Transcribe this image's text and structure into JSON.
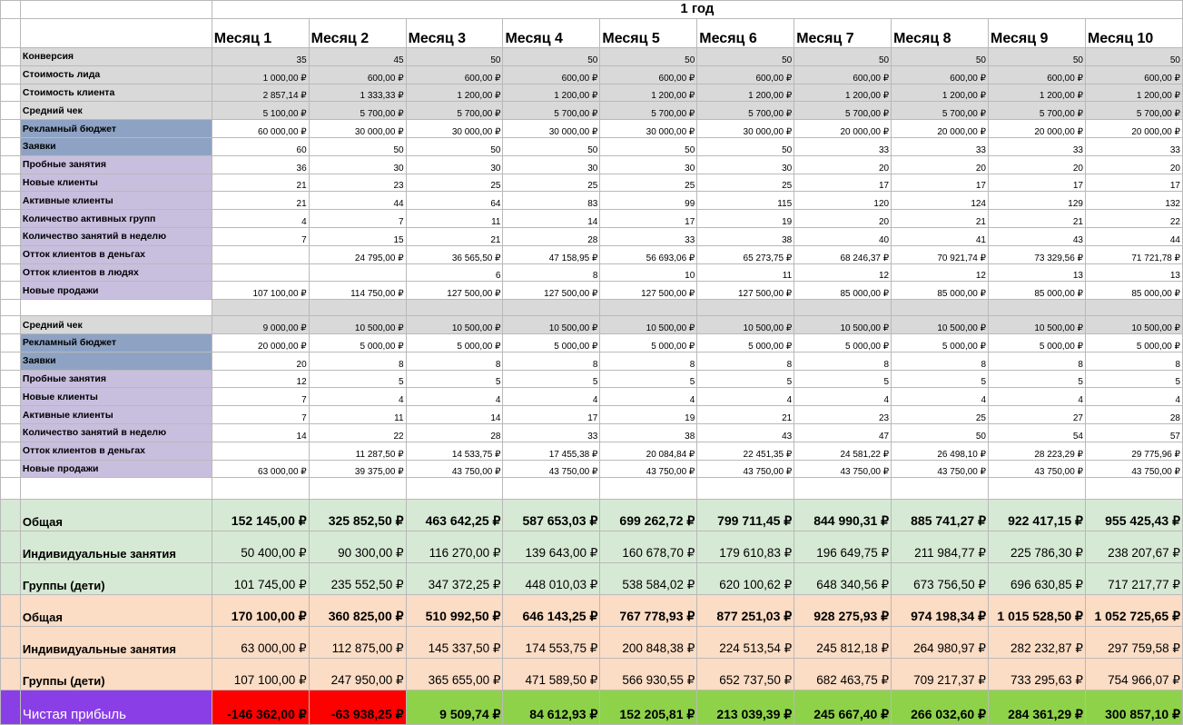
{
  "year_label": "1 год",
  "months": [
    "Месяц 1",
    "Месяц 2",
    "Месяц 3",
    "Месяц 4",
    "Месяц 5",
    "Месяц 6",
    "Месяц 7",
    "Месяц 8",
    "Месяц 9",
    "Месяц 10"
  ],
  "sections": [
    {
      "id": "individual",
      "rows": [
        {
          "label": "Конверсия",
          "label_bg": "gray",
          "cell_bg": "gray",
          "values": [
            "35",
            "45",
            "50",
            "50",
            "50",
            "50",
            "50",
            "50",
            "50",
            "50"
          ]
        },
        {
          "label": "Стоимость лида",
          "label_bg": "gray",
          "cell_bg": "gray",
          "values": [
            "1 000,00 ₽",
            "600,00 ₽",
            "600,00 ₽",
            "600,00 ₽",
            "600,00 ₽",
            "600,00 ₽",
            "600,00 ₽",
            "600,00 ₽",
            "600,00 ₽",
            "600,00 ₽"
          ]
        },
        {
          "label": "Стоимость клиента",
          "label_bg": "gray",
          "cell_bg": "gray",
          "values": [
            "2 857,14 ₽",
            "1 333,33 ₽",
            "1 200,00 ₽",
            "1 200,00 ₽",
            "1 200,00 ₽",
            "1 200,00 ₽",
            "1 200,00 ₽",
            "1 200,00 ₽",
            "1 200,00 ₽",
            "1 200,00 ₽"
          ]
        },
        {
          "label": "Средний чек",
          "label_bg": "gray",
          "cell_bg": "gray",
          "values": [
            "5 100,00 ₽",
            "5 700,00 ₽",
            "5 700,00 ₽",
            "5 700,00 ₽",
            "5 700,00 ₽",
            "5 700,00 ₽",
            "5 700,00 ₽",
            "5 700,00 ₽",
            "5 700,00 ₽",
            "5 700,00 ₽"
          ]
        },
        {
          "label": "Рекламный бюджет",
          "label_bg": "blue",
          "cell_bg": "white",
          "values": [
            "60 000,00 ₽",
            "30 000,00 ₽",
            "30 000,00 ₽",
            "30 000,00 ₽",
            "30 000,00 ₽",
            "30 000,00 ₽",
            "20 000,00 ₽",
            "20 000,00 ₽",
            "20 000,00 ₽",
            "20 000,00 ₽"
          ]
        },
        {
          "label": "Заявки",
          "label_bg": "blue",
          "cell_bg": "white",
          "values": [
            "60",
            "50",
            "50",
            "50",
            "50",
            "50",
            "33",
            "33",
            "33",
            "33"
          ]
        },
        {
          "label": "Пробные занятия",
          "label_bg": "purple",
          "cell_bg": "white",
          "values": [
            "36",
            "30",
            "30",
            "30",
            "30",
            "30",
            "20",
            "20",
            "20",
            "20"
          ]
        },
        {
          "label": "Новые клиенты",
          "label_bg": "purple",
          "cell_bg": "white",
          "values": [
            "21",
            "23",
            "25",
            "25",
            "25",
            "25",
            "17",
            "17",
            "17",
            "17"
          ]
        },
        {
          "label": "Активные клиенты",
          "label_bg": "purple",
          "cell_bg": "white",
          "values": [
            "21",
            "44",
            "64",
            "83",
            "99",
            "115",
            "120",
            "124",
            "129",
            "132"
          ]
        },
        {
          "label": "Количество активных групп",
          "label_bg": "purple",
          "cell_bg": "white",
          "values": [
            "4",
            "7",
            "11",
            "14",
            "17",
            "19",
            "20",
            "21",
            "21",
            "22"
          ]
        },
        {
          "label": "Количество занятий в неделю",
          "label_bg": "purple",
          "cell_bg": "white",
          "values": [
            "7",
            "15",
            "21",
            "28",
            "33",
            "38",
            "40",
            "41",
            "43",
            "44"
          ]
        },
        {
          "label": "Отток клиентов в деньгах",
          "label_bg": "purple",
          "cell_bg": "white",
          "values": [
            "",
            "24 795,00 ₽",
            "36 565,50 ₽",
            "47 158,95 ₽",
            "56 693,06 ₽",
            "65 273,75 ₽",
            "68 246,37 ₽",
            "70 921,74 ₽",
            "73 329,56 ₽",
            "71 721,78 ₽"
          ]
        },
        {
          "label": "Отток клиентов в людях",
          "label_bg": "purple",
          "cell_bg": "white",
          "values": [
            "",
            "",
            "6",
            "8",
            "10",
            "11",
            "12",
            "12",
            "13",
            "13"
          ]
        },
        {
          "label": "Новые продажи",
          "label_bg": "purple",
          "cell_bg": "white",
          "values": [
            "107 100,00 ₽",
            "114 750,00 ₽",
            "127 500,00 ₽",
            "127 500,00 ₽",
            "127 500,00 ₽",
            "127 500,00 ₽",
            "85 000,00 ₽",
            "85 000,00 ₽",
            "85 000,00 ₽",
            "85 000,00 ₽"
          ]
        }
      ]
    },
    {
      "id": "groups",
      "rows": [
        {
          "label": "Средний чек",
          "label_bg": "gray",
          "cell_bg": "gray",
          "values": [
            "9 000,00 ₽",
            "10 500,00 ₽",
            "10 500,00 ₽",
            "10 500,00 ₽",
            "10 500,00 ₽",
            "10 500,00 ₽",
            "10 500,00 ₽",
            "10 500,00 ₽",
            "10 500,00 ₽",
            "10 500,00 ₽"
          ]
        },
        {
          "label": "Рекламный бюджет",
          "label_bg": "blue",
          "cell_bg": "white",
          "values": [
            "20 000,00 ₽",
            "5 000,00 ₽",
            "5 000,00 ₽",
            "5 000,00 ₽",
            "5 000,00 ₽",
            "5 000,00 ₽",
            "5 000,00 ₽",
            "5 000,00 ₽",
            "5 000,00 ₽",
            "5 000,00 ₽"
          ]
        },
        {
          "label": "Заявки",
          "label_bg": "blue",
          "cell_bg": "white",
          "values": [
            "20",
            "8",
            "8",
            "8",
            "8",
            "8",
            "8",
            "8",
            "8",
            "8"
          ]
        },
        {
          "label": "Пробные занятия",
          "label_bg": "purple",
          "cell_bg": "white",
          "values": [
            "12",
            "5",
            "5",
            "5",
            "5",
            "5",
            "5",
            "5",
            "5",
            "5"
          ]
        },
        {
          "label": "Новые клиенты",
          "label_bg": "purple",
          "cell_bg": "white",
          "values": [
            "7",
            "4",
            "4",
            "4",
            "4",
            "4",
            "4",
            "4",
            "4",
            "4"
          ]
        },
        {
          "label": "Активные клиенты",
          "label_bg": "purple",
          "cell_bg": "white",
          "values": [
            "7",
            "11",
            "14",
            "17",
            "19",
            "21",
            "23",
            "25",
            "27",
            "28"
          ]
        },
        {
          "label": "Количество занятий в неделю",
          "label_bg": "purple",
          "cell_bg": "white",
          "values": [
            "14",
            "22",
            "28",
            "33",
            "38",
            "43",
            "47",
            "50",
            "54",
            "57"
          ]
        },
        {
          "label": "Отток клиентов в деньгах",
          "label_bg": "purple",
          "cell_bg": "white",
          "values": [
            "",
            "11 287,50 ₽",
            "14 533,75 ₽",
            "17 455,38 ₽",
            "20 084,84 ₽",
            "22 451,35 ₽",
            "24 581,22 ₽",
            "26 498,10 ₽",
            "28 223,29 ₽",
            "29 775,96 ₽"
          ]
        },
        {
          "label": "Новые продажи",
          "label_bg": "purple",
          "cell_bg": "white",
          "values": [
            "63 000,00 ₽",
            "39 375,00 ₽",
            "43 750,00 ₽",
            "43 750,00 ₽",
            "43 750,00 ₽",
            "43 750,00 ₽",
            "43 750,00 ₽",
            "43 750,00 ₽",
            "43 750,00 ₽",
            "43 750,00 ₽"
          ]
        }
      ]
    }
  ],
  "summary": [
    {
      "label": "Общая",
      "bg": "green",
      "bold": true,
      "values": [
        "152 145,00 ₽",
        "325 852,50 ₽",
        "463 642,25 ₽",
        "587 653,03 ₽",
        "699 262,72 ₽",
        "799 711,45 ₽",
        "844 990,31 ₽",
        "885 741,27 ₽",
        "922 417,15 ₽",
        "955 425,43 ₽"
      ]
    },
    {
      "label": "Индивидуальные занятия",
      "bg": "green",
      "bold": false,
      "values": [
        "50 400,00 ₽",
        "90 300,00 ₽",
        "116 270,00 ₽",
        "139 643,00 ₽",
        "160 678,70 ₽",
        "179 610,83 ₽",
        "196 649,75 ₽",
        "211 984,77 ₽",
        "225 786,30 ₽",
        "238 207,67 ₽"
      ]
    },
    {
      "label": "Группы (дети)",
      "bg": "green",
      "bold": false,
      "values": [
        "101 745,00 ₽",
        "235 552,50 ₽",
        "347 372,25 ₽",
        "448 010,03 ₽",
        "538 584,02 ₽",
        "620 100,62 ₽",
        "648 340,56 ₽",
        "673 756,50 ₽",
        "696 630,85 ₽",
        "717 217,77 ₽"
      ]
    },
    {
      "label": "Общая",
      "bg": "orange",
      "bold": true,
      "values": [
        "170 100,00 ₽",
        "360 825,00 ₽",
        "510 992,50 ₽",
        "646 143,25 ₽",
        "767 778,93 ₽",
        "877 251,03 ₽",
        "928 275,93 ₽",
        "974 198,34 ₽",
        "1 015 528,50 ₽",
        "1 052 725,65 ₽"
      ]
    },
    {
      "label": "Индивидуальные занятия",
      "bg": "orange",
      "bold": false,
      "values": [
        "63 000,00 ₽",
        "112 875,00 ₽",
        "145 337,50 ₽",
        "174 553,75 ₽",
        "200 848,38 ₽",
        "224 513,54 ₽",
        "245 812,18 ₽",
        "264 980,97 ₽",
        "282 232,87 ₽",
        "297 759,58 ₽"
      ]
    },
    {
      "label": "Группы (дети)",
      "bg": "orange",
      "bold": false,
      "values": [
        "107 100,00 ₽",
        "247 950,00 ₽",
        "365 655,00 ₽",
        "471 589,50 ₽",
        "566 930,55 ₽",
        "652 737,50 ₽",
        "682 463,75 ₽",
        "709 217,37 ₽",
        "733 295,63 ₽",
        "754 966,07 ₽"
      ]
    }
  ],
  "profit": {
    "label": "Чистая прибыль",
    "label_bg": "violet",
    "values": [
      "-146 362,00 ₽",
      "-63 938,25 ₽",
      "9 509,74 ₽",
      "84 612,93 ₽",
      "152 205,81 ₽",
      "213 039,39 ₽",
      "245 667,40 ₽",
      "266 032,60 ₽",
      "284 361,29 ₽",
      "300 857,10 ₽"
    ],
    "cell_bgs": [
      "red",
      "red",
      "lime",
      "lime",
      "lime",
      "lime",
      "lime",
      "lime",
      "lime",
      "lime"
    ]
  },
  "colors": {
    "gray": "#d9d9d9",
    "blue": "#8ea3c4",
    "purple": "#c8bfdf",
    "white": "#ffffff",
    "green": "#d6e9d4",
    "orange": "#fbdcc4",
    "violet": "#8a3ee6",
    "red": "#ff0000",
    "lime": "#8ed24a"
  }
}
